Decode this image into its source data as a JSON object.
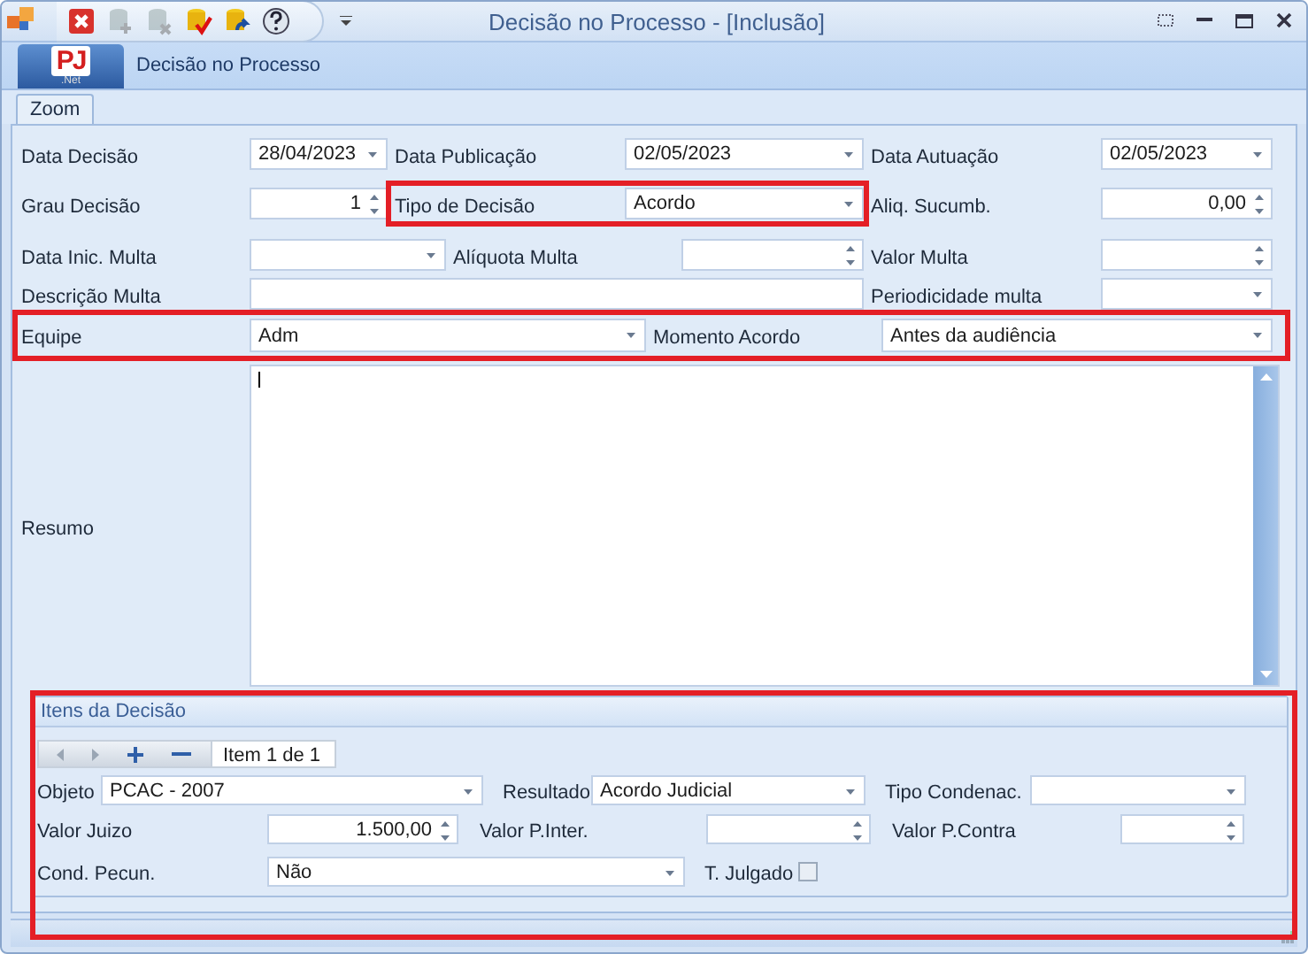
{
  "window": {
    "title": "Decisão no Processo - [Inclusão]"
  },
  "quick_access": [
    {
      "kind": "close",
      "disabled": false
    },
    {
      "kind": "add",
      "disabled": true
    },
    {
      "kind": "remove",
      "disabled": true
    },
    {
      "kind": "save",
      "disabled": false
    },
    {
      "kind": "undo",
      "disabled": false
    },
    {
      "kind": "help",
      "disabled": false
    }
  ],
  "ribbon": {
    "logo": "PJ",
    "logo_sub": ".Net",
    "page_title": "Decisão no Processo"
  },
  "tabs": [
    {
      "label": "Zoom",
      "selected": true
    }
  ],
  "form_rows": [
    [
      {
        "label": "Data Decisão",
        "field": {
          "kind": "date",
          "value": "28/04/2023"
        }
      },
      {
        "label": "Data Publicação",
        "field": {
          "kind": "date",
          "value": "02/05/2023"
        }
      },
      {
        "label": "Data Autuação",
        "field": {
          "kind": "date",
          "value": "02/05/2023"
        }
      }
    ],
    [
      {
        "label": "Grau Decisão",
        "field": {
          "kind": "spin",
          "value": "1"
        }
      },
      {
        "label": "Tipo de Decisão",
        "field": {
          "kind": "combo",
          "value": "Acordo"
        }
      },
      {
        "label": "Aliq. Sucumb.",
        "field": {
          "kind": "spin",
          "value": "0,00"
        }
      }
    ],
    [
      {
        "label": "Data Inic. Multa",
        "field": {
          "kind": "date"
        }
      },
      {
        "label": "Alíquota Multa",
        "field": {
          "kind": "spin"
        }
      },
      {
        "label": "Valor Multa",
        "field": {
          "kind": "spin"
        }
      }
    ],
    [
      {
        "label": "Descrição Multa",
        "field": {
          "kind": "text"
        }
      },
      {
        "label": "Periodicidade multa",
        "field": {
          "kind": "combo"
        }
      }
    ],
    [
      {
        "label": "Equipe",
        "field": {
          "kind": "combo",
          "value": "Adm"
        }
      },
      {
        "label": "Momento Acordo",
        "field": {
          "kind": "combo",
          "value": "Antes da audiência"
        }
      }
    ]
  ],
  "summary": {
    "label": "Resumo"
  },
  "items_group": {
    "title": "Itens da Decisão",
    "navigator": {
      "position": "Item 1 de 1"
    },
    "rows": [
      [
        {
          "label": "Objeto",
          "field": {
            "kind": "combo",
            "value": "PCAC - 2007"
          }
        },
        {
          "label": "Resultado",
          "field": {
            "kind": "combo",
            "value": "Acordo Judicial"
          }
        },
        {
          "label": "Tipo Condenac.",
          "field": {
            "kind": "combo"
          }
        }
      ],
      [
        {
          "label": "Valor Juizo",
          "field": {
            "kind": "spin",
            "value": "1.500,00"
          }
        },
        {
          "label": "Valor P.Inter.",
          "field": {
            "kind": "spin"
          }
        },
        {
          "label": "Valor P.Contra",
          "field": {
            "kind": "spin"
          }
        }
      ],
      [
        {
          "label": "Cond. Pecun.",
          "field": {
            "kind": "combo",
            "value": "Não"
          }
        },
        {
          "label": "T. Julgado",
          "field": {
            "kind": "checkbox",
            "checked": false
          }
        }
      ]
    ]
  },
  "annotations": [
    {
      "kind": "rectangle"
    },
    {
      "kind": "rectangle"
    },
    {
      "kind": "rectangle"
    }
  ]
}
